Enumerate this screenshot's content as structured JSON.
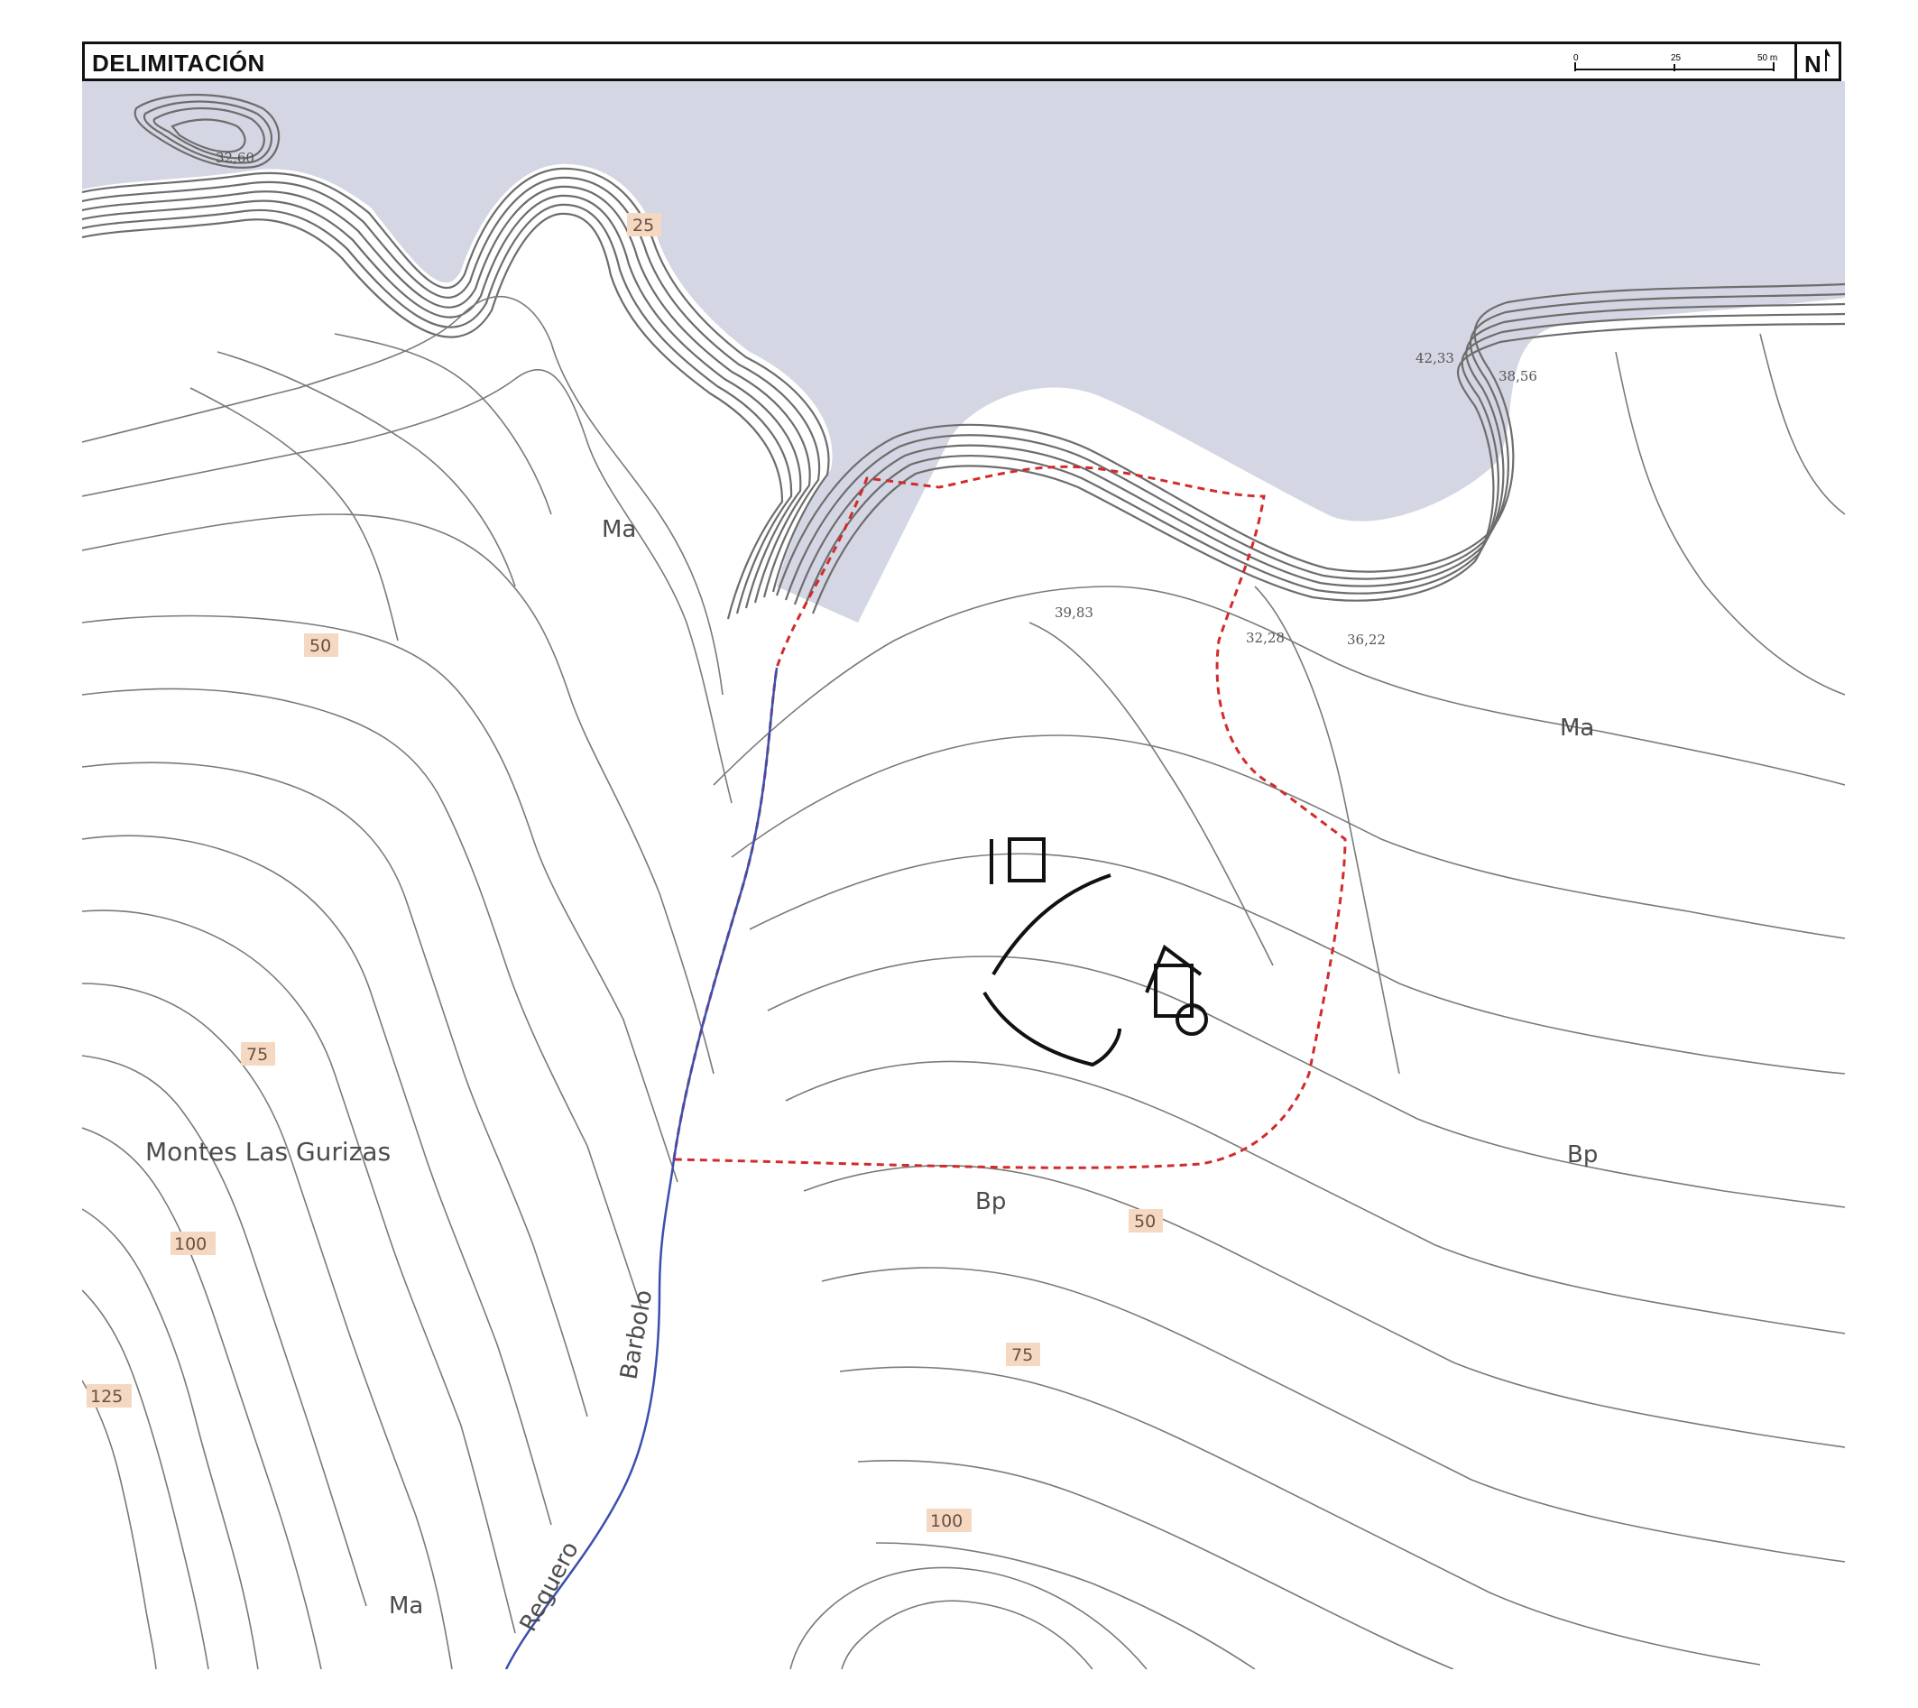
{
  "header": {
    "title": "DELIMITACIÓN",
    "scale_ticks": [
      "0",
      "25",
      "50 m"
    ],
    "north": "N"
  },
  "colors": {
    "sea": "#d4d6e3",
    "contour": "#6d6d6d",
    "boundary": "#d12c2c",
    "stream": "#3b4fae",
    "label_tag": "#f5d8c2"
  },
  "labels": {
    "ma_1": "Ma",
    "ma_2": "Ma",
    "ma_3": "Ma",
    "bp_1": "Bp",
    "bp_2": "Bp",
    "place": "Montes Las Gurizas",
    "stream_1": "Barbolo",
    "stream_2": "Reguero"
  },
  "contour_labels": {
    "c25": "25",
    "c50a": "50",
    "c50b": "50",
    "c75a": "75",
    "c75b": "75",
    "c100a": "100",
    "c100b": "100",
    "c125": "125"
  },
  "spot_heights": {
    "s1": "32,60",
    "s2": "39,83",
    "s3": "32,28",
    "s4": "36,22",
    "s5": "42,33",
    "s6": "38,56"
  }
}
